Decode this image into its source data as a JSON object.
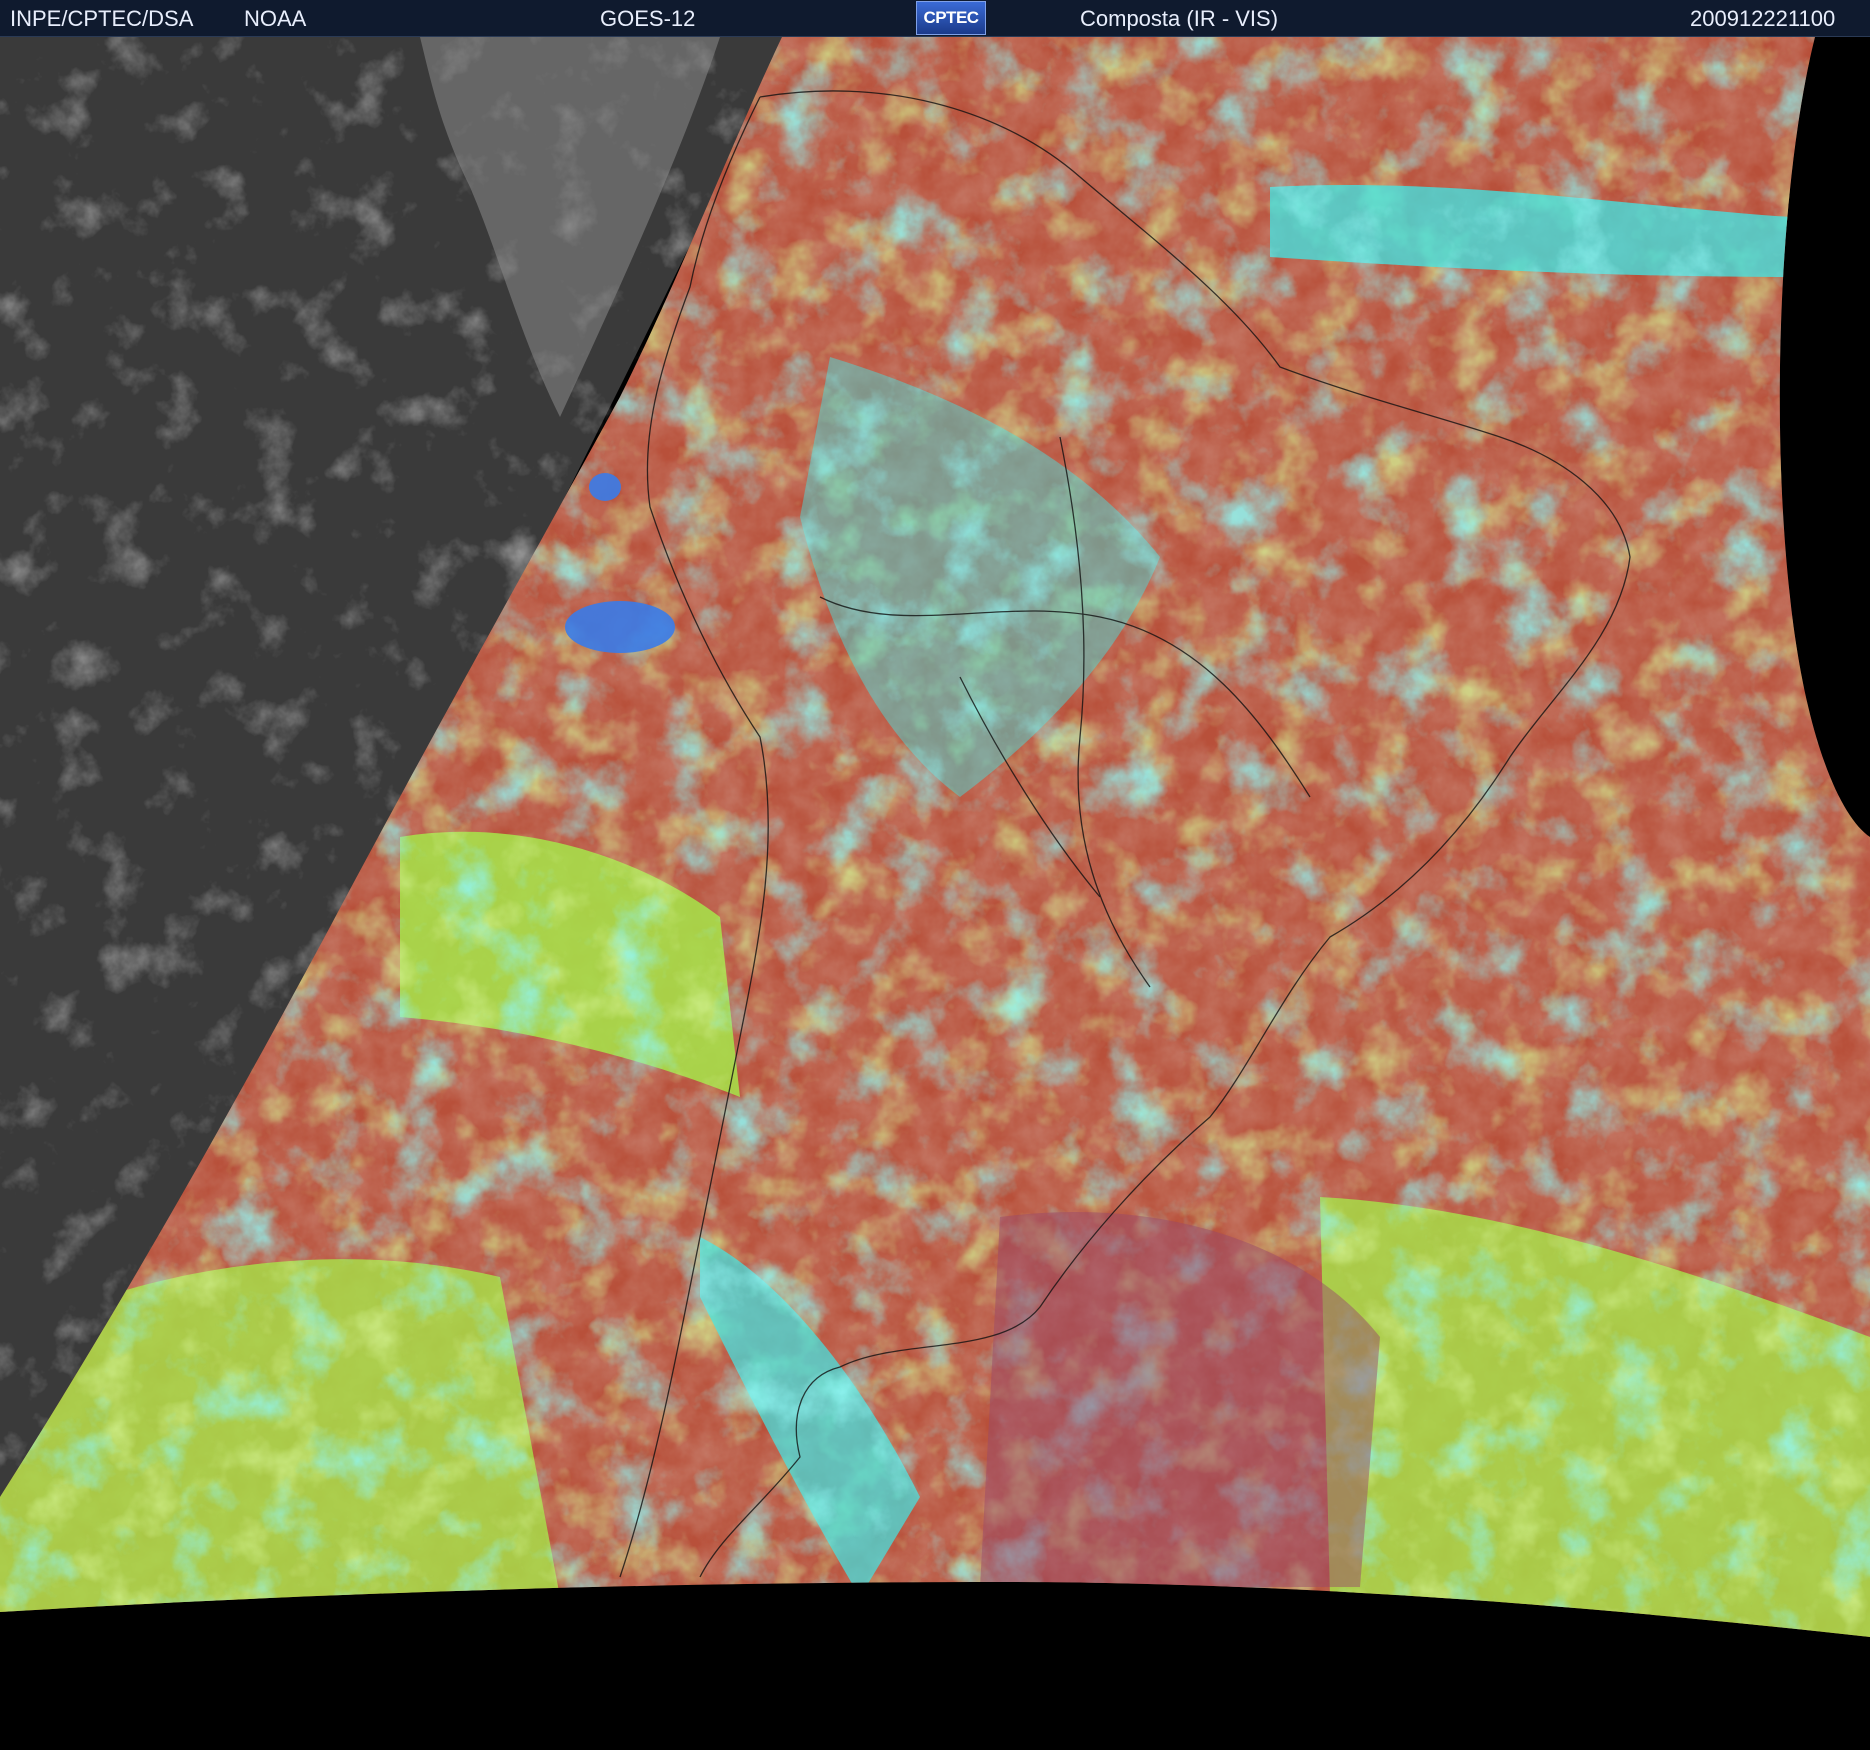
{
  "header": {
    "left_agency": "INPE/CPTEC/DSA",
    "left_source": "NOAA",
    "satellite": "GOES-12",
    "logo_text": "CPTEC",
    "product": "Composta (IR - VIS)",
    "timestamp": "200912221100"
  },
  "colors": {
    "header_bg": "#0f1a2e",
    "night_gray": "#3a3a3a",
    "cloud_cyan": "#3ee8e8",
    "land_red": "#b8503a",
    "ocean_green": "#a6e64a",
    "deep_blue": "#3a7be8"
  },
  "icons": [
    "cptec-logo-icon"
  ]
}
